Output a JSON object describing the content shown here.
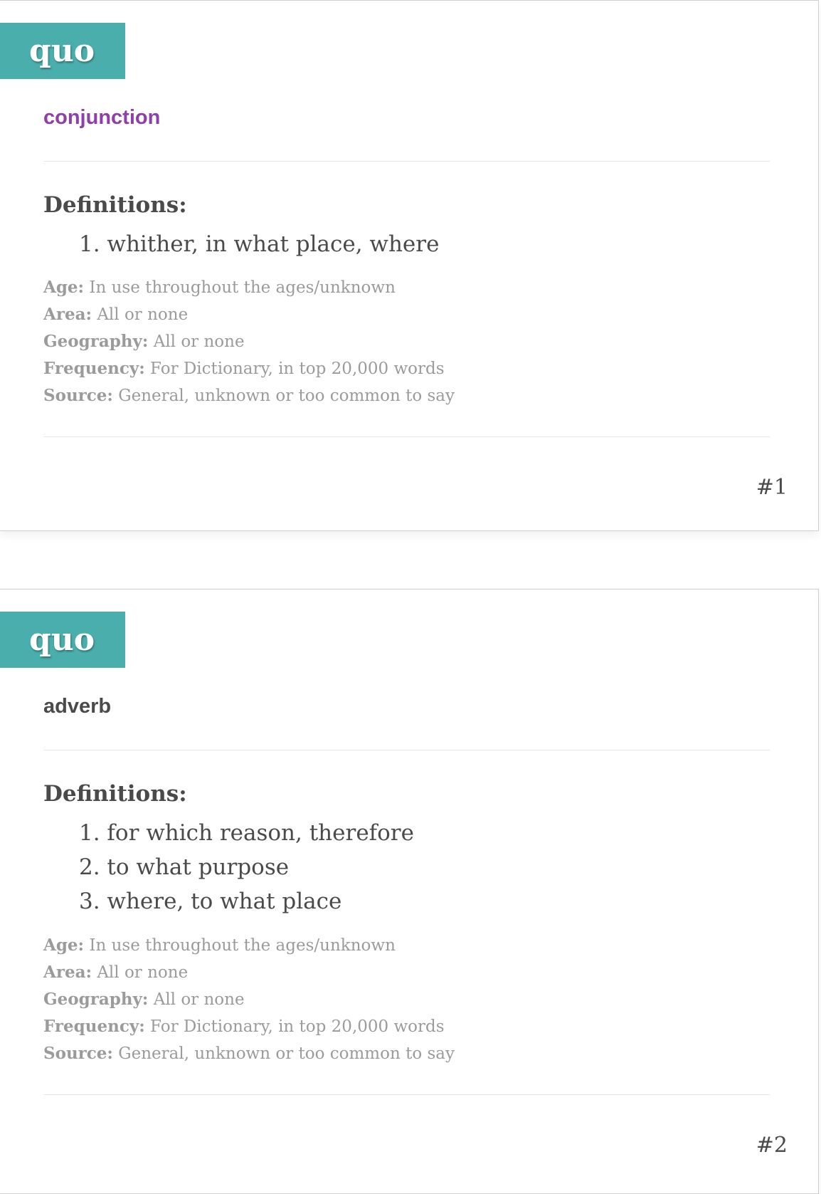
{
  "entries": [
    {
      "headword": "quo",
      "part_of_speech": "conjunction",
      "definitions_heading": "Definitions:",
      "definitions": [
        "1. whither, in what place, where"
      ],
      "meta": {
        "age_label": "Age:",
        "age": "In use throughout the ages/unknown",
        "area_label": "Area:",
        "area": "All or none",
        "geography_label": "Geography:",
        "geography": "All or none",
        "frequency_label": "Frequency:",
        "frequency": "For Dictionary, in top 20,000 words",
        "source_label": "Source:",
        "source": "General, unknown or too common to say"
      },
      "number": "#1"
    },
    {
      "headword": "quo",
      "part_of_speech": "adverb",
      "definitions_heading": "Definitions:",
      "definitions": [
        "1. for which reason, therefore",
        "2. to what purpose",
        "3. where, to what place"
      ],
      "meta": {
        "age_label": "Age:",
        "age": "In use throughout the ages/unknown",
        "area_label": "Area:",
        "area": "All or none",
        "geography_label": "Geography:",
        "geography": "All or none",
        "frequency_label": "Frequency:",
        "frequency": "For Dictionary, in top 20,000 words",
        "source_label": "Source:",
        "source": "General, unknown or too common to say"
      },
      "number": "#2"
    }
  ],
  "colors": {
    "headword_bg": "#49aeac",
    "pos_conjunction": "#8e3fa8",
    "pos_adverb": "#4a4a4a",
    "meta_text": "#9b9b9b"
  }
}
